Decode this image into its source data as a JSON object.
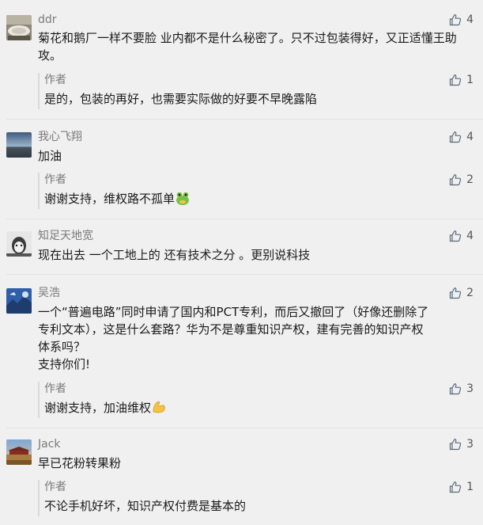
{
  "comments": [
    {
      "nickname": "ddr",
      "likes": "4",
      "text": "菊花和鹅厂一样不要脸 业内都不是什么秘密了。只不过包装得好，又正适懂王助攻。",
      "reply": {
        "author": "作者",
        "likes": "1",
        "text": "是的，包装的再好，也需要实际做的好要不早晚露陷"
      }
    },
    {
      "nickname": "我心飞翔",
      "likes": "4",
      "text": "加油",
      "reply": {
        "author": "作者",
        "likes": "2",
        "text": "谢谢支持，维权路不孤单",
        "emoji": "frog-emoji"
      }
    },
    {
      "nickname": "知足天地宽",
      "likes": "4",
      "text": "现在出去 一个工地上的 还有技术之分 。更别说科技"
    },
    {
      "nickname": "吴浩",
      "likes": "2",
      "text_lines": [
        "一个“普遍电路”同时申请了国内和PCT专利，而后又撤回了（好像还删除了",
        "专利文本），这是什么套路？华为不是尊重知识产权，建有完善的知识产权",
        "体系吗？",
        "支持你们!"
      ],
      "reply": {
        "author": "作者",
        "likes": "3",
        "text": "谢谢支持，加油维权",
        "emoji": "flexed-biceps-emoji"
      }
    },
    {
      "nickname": "Jack",
      "likes": "3",
      "text": "早已花粉转果粉",
      "reply": {
        "author": "作者",
        "likes": "1",
        "text": "不论手机好坏，知识产权付费是基本的"
      }
    }
  ],
  "colors": {
    "background": "#f0f0f0",
    "nickname": "#7a7a7a",
    "text": "#1a1a1a",
    "reply_bar": "#d9d9d9"
  },
  "icons": {
    "like": "thumbs-up-icon"
  }
}
